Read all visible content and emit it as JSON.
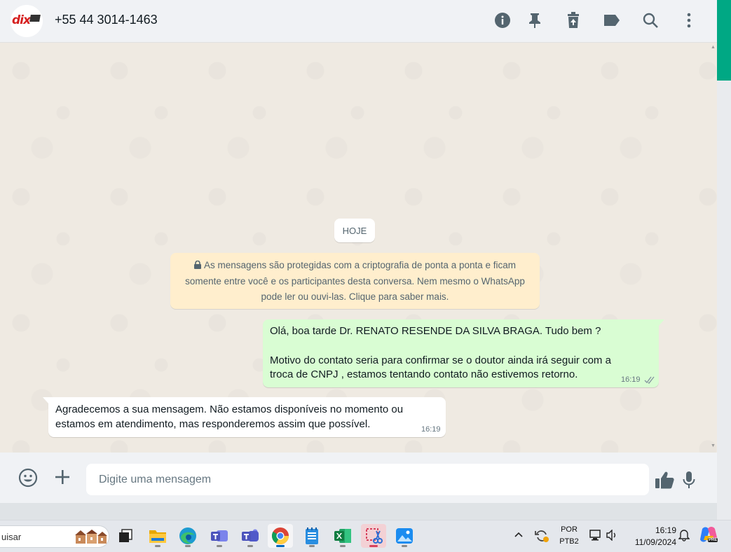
{
  "header": {
    "contact_name": "+55 44 3014-1463",
    "avatar_logo_text": "dix",
    "icons": [
      "info-icon",
      "pin-icon",
      "delete-icon",
      "label-icon",
      "search-icon",
      "more-vertical-icon"
    ]
  },
  "chat": {
    "day_chip": "HOJE",
    "encryption_notice": {
      "line1": "As mensagens são protegidas com a criptografia de ponta a ponta e ficam",
      "line2": "somente entre você e os participantes desta conversa. Nem mesmo o WhatsApp",
      "line3": "pode ler ou ouvi-las. Clique para saber mais."
    },
    "messages": [
      {
        "direction": "outgoing",
        "lines": [
          "Olá, boa tarde Dr.  RENATO RESENDE DA SILVA BRAGA. Tudo bem ?",
          "",
          " Motivo do contato seria para confirmar se o doutor ainda irá seguir com a",
          "troca de CNPJ , estamos tentando contato não estivemos retorno."
        ],
        "time": "16:19",
        "status": "read-double-check"
      },
      {
        "direction": "incoming",
        "lines": [
          "Agradecemos a sua mensagem. Não estamos disponíveis no momento ou",
          "estamos em atendimento, mas responderemos assim que possível."
        ],
        "time": "16:19"
      }
    ]
  },
  "composer": {
    "placeholder": "Digite uma mensagem",
    "value": ""
  },
  "taskbar": {
    "search_text": "uisar",
    "apps": [
      "file-explorer",
      "task-view",
      "folder",
      "edge",
      "teams",
      "teams-classic",
      "chrome",
      "notepad",
      "excel",
      "snipping-tool",
      "photos"
    ],
    "active_app": "chrome",
    "language_top": "POR",
    "language_bottom": "PTB2",
    "clock_time": "16:19",
    "clock_date": "11/09/2024",
    "copilot_badge": "PRE"
  },
  "colors": {
    "accent_green": "#00a884",
    "outgoing_bubble": "#d9fdd3",
    "notice_bg": "#ffeecd",
    "chat_bg": "#efeae2"
  }
}
